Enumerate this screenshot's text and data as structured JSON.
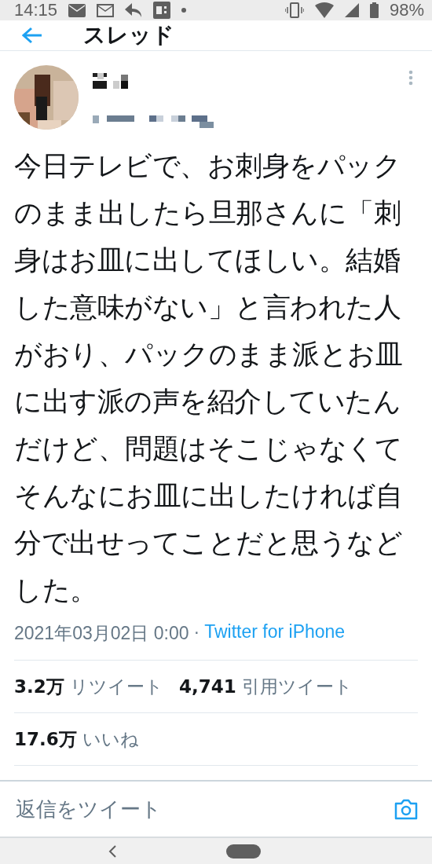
{
  "status_bar": {
    "time": "14:15",
    "battery": "98%"
  },
  "header": {
    "title": "スレッド"
  },
  "tweet": {
    "text": "今日テレビで、お刺身をパックのまま出したら旦那さんに「刺身はお皿に出してほしい。結婚した意味がない」と言われた人がおり、パックのまま派とお皿に出す派の声を紹介していたんだけど、問題はそこじゃなくてそんなにお皿に出したければ自分で出せってことだと思うなどした。",
    "date": "2021年03月02日 0:00",
    "separator": "·",
    "source": "Twitter for iPhone"
  },
  "stats": [
    {
      "count": "3.2万",
      "label": "リツイート"
    },
    {
      "count": "4,741",
      "label": "引用ツイート"
    }
  ],
  "likes": {
    "count": "17.6万",
    "label": "いいね"
  },
  "reply": {
    "placeholder": "返信をツイート"
  }
}
